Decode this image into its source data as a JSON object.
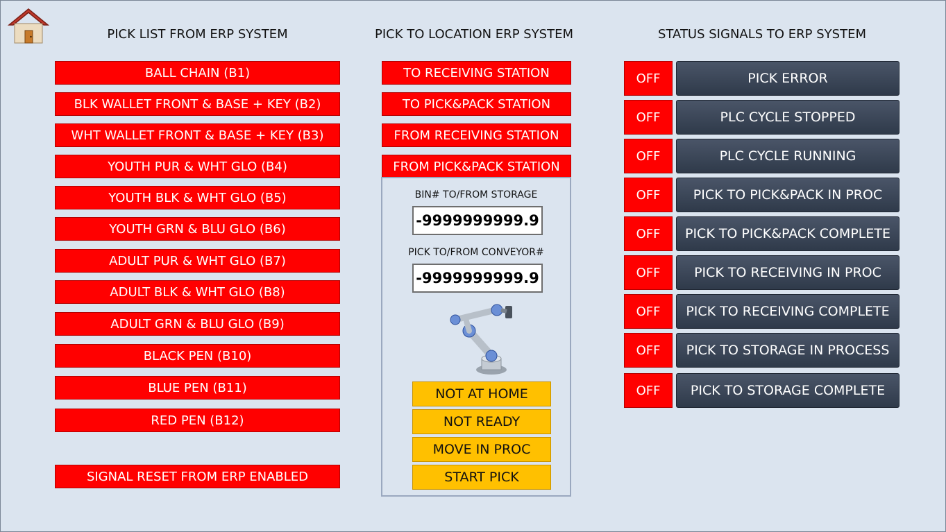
{
  "titles": {
    "pick_list": "PICK LIST FROM ERP SYSTEM",
    "pick_to_location": "PICK TO LOCATION ERP SYSTEM",
    "status_signals": "STATUS SIGNALS TO ERP SYSTEM"
  },
  "pick_list": [
    "BALL CHAIN (B1)",
    "BLK WALLET FRONT & BASE + KEY (B2)",
    "WHT WALLET FRONT & BASE + KEY (B3)",
    "YOUTH PUR & WHT GLO (B4)",
    "YOUTH BLK & WHT GLO (B5)",
    "YOUTH GRN & BLU GLO (B6)",
    "ADULT PUR & WHT GLO (B7)",
    "ADULT BLK & WHT GLO (B8)",
    "ADULT GRN & BLU GLO (B9)",
    "BLACK PEN (B10)",
    "BLUE PEN (B11)",
    "RED PEN (B12)"
  ],
  "signal_reset": "SIGNAL RESET FROM ERP ENABLED",
  "locations": [
    "TO RECEIVING STATION",
    "TO PICK&PACK STATION",
    "FROM RECEIVING STATION",
    "FROM PICK&PACK STATION"
  ],
  "storage": {
    "bin_label": "BIN# TO/FROM STORAGE",
    "bin_value": "-9999999999.9",
    "conveyor_label": "PICK TO/FROM CONVEYOR#",
    "conveyor_value": "-9999999999.9"
  },
  "robot_status": [
    "NOT AT HOME",
    "NOT READY",
    "MOVE IN PROC",
    "START PICK"
  ],
  "status_signals": [
    {
      "state": "OFF",
      "label": "PICK ERROR"
    },
    {
      "state": "OFF",
      "label": "PLC CYCLE STOPPED"
    },
    {
      "state": "OFF",
      "label": "PLC CYCLE RUNNING"
    },
    {
      "state": "OFF",
      "label": "PICK TO PICK&PACK IN PROC"
    },
    {
      "state": "OFF",
      "label": "PICK TO PICK&PACK COMPLETE"
    },
    {
      "state": "OFF",
      "label": "PICK TO RECEIVING IN PROC"
    },
    {
      "state": "OFF",
      "label": "PICK TO RECEIVING COMPLETE"
    },
    {
      "state": "OFF",
      "label": "PICK TO STORAGE IN PROCESS"
    },
    {
      "state": "OFF",
      "label": "PICK TO STORAGE COMPLETE"
    }
  ],
  "icons": {
    "home": "home-icon",
    "robot": "robot-arm-icon"
  },
  "colors": {
    "background": "#dbe4ef",
    "alarm_red": "#ff0000",
    "status_yellow": "#ffc000",
    "button_dark": "#2f3a4a"
  }
}
